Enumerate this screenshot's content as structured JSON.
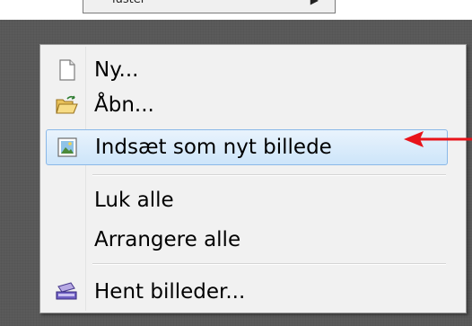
{
  "background_menu": {
    "partial_label": "luster",
    "submenu_arrow": "▶"
  },
  "context_menu": {
    "items": [
      {
        "label": "Ny...",
        "icon": "new-document-icon"
      },
      {
        "label": "Åbn...",
        "icon": "open-folder-icon"
      },
      {
        "label": "Indsæt som nyt billede",
        "icon": "paste-as-new-image-icon",
        "highlighted": true
      },
      {
        "label": "Luk alle"
      },
      {
        "label": "Arrangere alle"
      },
      {
        "label": "Hent billeder...",
        "icon": "scanner-icon"
      }
    ]
  },
  "annotation": {
    "arrow_color": "#e8131a",
    "points_to": "Indsæt som nyt billede"
  }
}
